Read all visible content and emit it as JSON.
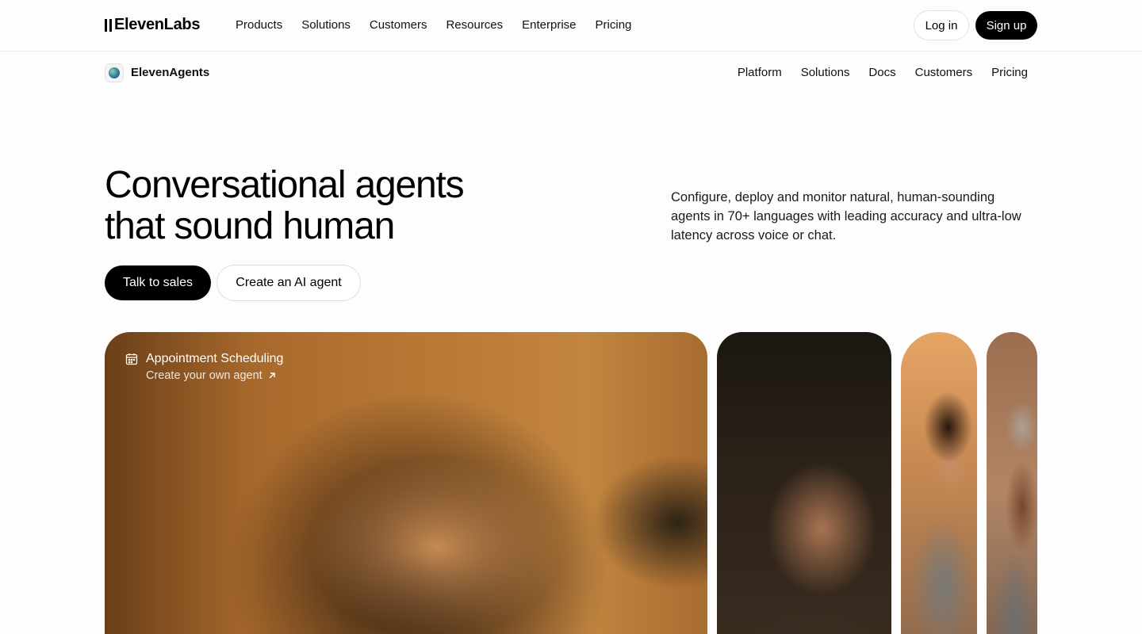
{
  "header": {
    "logo_text": "ElevenLabs",
    "menu": [
      "Products",
      "Solutions",
      "Customers",
      "Resources",
      "Enterprise",
      "Pricing"
    ],
    "login_label": "Log in",
    "signup_label": "Sign up"
  },
  "subnav": {
    "brand_name": "ElevenAgents",
    "brand_icon": "eleven-agents-orb-icon",
    "menu": [
      "Platform",
      "Solutions",
      "Docs",
      "Customers",
      "Pricing"
    ]
  },
  "hero": {
    "title_line1": "Conversational agents",
    "title_line2": "that sound human",
    "description": "Configure, deploy and monitor natural, human-sounding agents in 70+ languages with leading accuracy and ultra-low latency across voice or chat.",
    "primary_cta": "Talk to sales",
    "secondary_cta": "Create an AI agent"
  },
  "gallery": {
    "active_card": {
      "icon": "calendar-icon",
      "title": "Appointment Scheduling",
      "link_label": "Create your own agent",
      "link_icon": "arrow-up-right-icon"
    }
  },
  "colors": {
    "primary": "#000000",
    "background": "#fdfdfd",
    "border": "#e1e1e1"
  }
}
